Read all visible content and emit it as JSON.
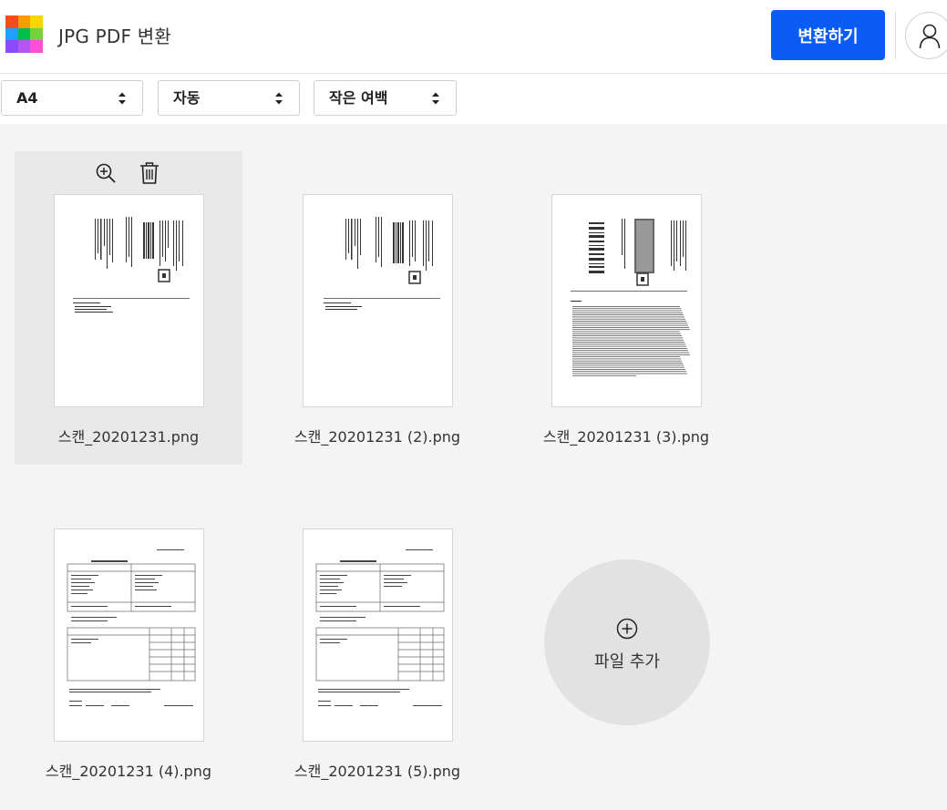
{
  "header": {
    "title": "JPG PDF 변환",
    "convert_label": "변환하기",
    "logo_colors": [
      "#f44d1a",
      "#ff9b00",
      "#ffd500",
      "#1fa1ff",
      "#00c04b",
      "#76d23a",
      "#8a4bff",
      "#b455f0",
      "#ff4fd8"
    ]
  },
  "toolbar": {
    "page_size": "A4",
    "orientation": "자동",
    "margin": "작은 여백"
  },
  "files": [
    {
      "name": "스캔_20201231.png",
      "selected": true,
      "kind": "label"
    },
    {
      "name": "스캔_20201231 (2).png",
      "selected": false,
      "kind": "label"
    },
    {
      "name": "스캔_20201231 (3).png",
      "selected": false,
      "kind": "label-dense"
    },
    {
      "name": "스캔_20201231 (4).png",
      "selected": false,
      "kind": "invoice"
    },
    {
      "name": "스캔_20201231 (5).png",
      "selected": false,
      "kind": "invoice"
    }
  ],
  "add_file": {
    "label": "파일 추가"
  },
  "colors": {
    "accent": "#0a5cf5",
    "background": "#f4f4f4"
  }
}
